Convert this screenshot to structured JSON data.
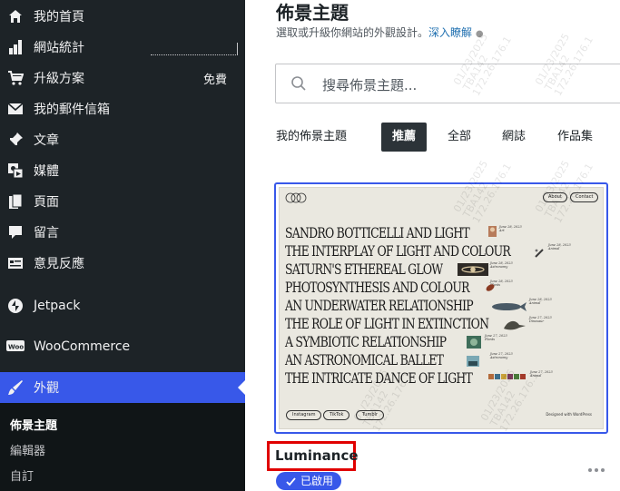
{
  "sidebar": {
    "items": [
      {
        "label": "我的首頁",
        "icon": "home-icon"
      },
      {
        "label": "網站統計",
        "icon": "stats-icon"
      },
      {
        "label": "升級方案",
        "icon": "cart-icon",
        "badge": "免費"
      },
      {
        "label": "我的郵件信箱",
        "icon": "mail-icon"
      },
      {
        "label": "文章",
        "icon": "pin-icon"
      },
      {
        "label": "媒體",
        "icon": "media-icon"
      },
      {
        "label": "頁面",
        "icon": "pages-icon"
      },
      {
        "label": "留言",
        "icon": "comment-icon"
      },
      {
        "label": "意見反應",
        "icon": "feedback-icon"
      },
      {
        "label": "Jetpack",
        "icon": "jetpack-icon"
      },
      {
        "label": "WooCommerce",
        "icon": "woo-icon"
      },
      {
        "label": "外觀",
        "icon": "appearance-icon"
      }
    ],
    "submenu": [
      "佈景主題",
      "編輯器",
      "自訂"
    ]
  },
  "main": {
    "title": "佈景主題",
    "subtitle": "選取或升級你網站的外觀設計。",
    "subtitle_link": "深入瞭解",
    "search_placeholder": "搜尋佈景主題...",
    "tabs": [
      "我的佈景主題",
      "推薦",
      "全部",
      "網誌",
      "作品集"
    ],
    "active_tab": "推薦",
    "theme": {
      "name": "Luminance",
      "status": "已啟用",
      "preview": {
        "nav": [
          "About",
          "Contact"
        ],
        "rows": [
          "SANDRO BOTTICELLI AND LIGHT",
          "THE INTERPLAY OF LIGHT AND COLOUR",
          "SATURN'S ETHEREAL GLOW",
          "PHOTOSYNTHESIS AND COLOUR",
          "AN UNDERWATER RELATIONSHIP",
          "THE ROLE OF LIGHT IN EXTINCTION",
          "A SYMBIOTIC RELATIONSHIP",
          "AN ASTRONOMICAL BALLET",
          "THE INTRICATE DANCE OF LIGHT"
        ],
        "meta": [
          [
            "June 28, 2023",
            "Art"
          ],
          [
            "June 28, 2023",
            "Animal"
          ],
          [
            "June 28, 2023",
            "Astronomy"
          ],
          [
            "June 28, 2023",
            "Plants"
          ],
          [
            "June 28, 2023",
            "Animal"
          ],
          [
            "June 27, 2023",
            "Dinosaur"
          ],
          [
            "June 27, 2023",
            "Plants"
          ],
          [
            "June 27, 2023",
            "Astronomy"
          ],
          [
            "June 27, 2023",
            "Animal"
          ]
        ],
        "footer": [
          "Instagram",
          "TikTok",
          "Tumblr"
        ],
        "credit": "Designed with WordPress"
      }
    }
  },
  "watermark": "01/23/2025\nTBA142\n172.26.176.1"
}
